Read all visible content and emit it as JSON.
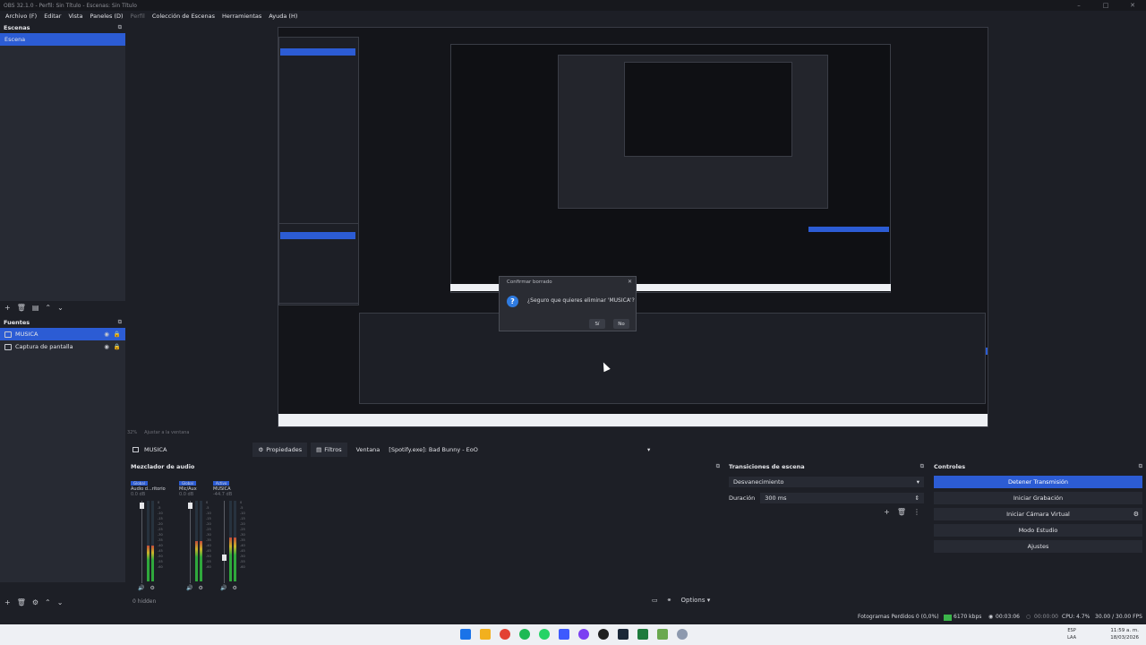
{
  "window": {
    "title": "OBS 32.1.0 - Perfil: Sin Título - Escenas: Sin Título"
  },
  "menu": [
    {
      "label": "Archivo (F)",
      "disabled": false
    },
    {
      "label": "Editar",
      "disabled": false
    },
    {
      "label": "Vista",
      "disabled": false
    },
    {
      "label": "Paneles (D)",
      "disabled": false
    },
    {
      "label": "Perfil",
      "disabled": true
    },
    {
      "label": "Colección de Escenas",
      "disabled": false
    },
    {
      "label": "Herramientas",
      "disabled": false
    },
    {
      "label": "Ayuda (H)",
      "disabled": false
    }
  ],
  "scenes": {
    "title": "Escenas",
    "items": [
      "Escena"
    ]
  },
  "sources": {
    "title": "Fuentes",
    "items": [
      "MUSICA",
      "Captura de pantalla"
    ]
  },
  "dialog": {
    "title": "Confirmar borrado",
    "message": "¿Seguro que quieres eliminar 'MUSICA'?",
    "yes": "Sí",
    "no": "No"
  },
  "preview": {
    "zoom": "32%",
    "zoom_mode": "Ajustar a la ventana"
  },
  "sourcebar": {
    "source": "MUSICA",
    "properties": "Propiedades",
    "filters": "Filtros",
    "window_label": "Ventana",
    "window_value": "[Spotify.exe]: Bad Bunny - EoO"
  },
  "mixer": {
    "title": "Mezclador de audio",
    "hidden": "0 hidden",
    "channels": [
      {
        "name": "Audio d...ritorio",
        "db": "0.0 dB",
        "tag": "Global",
        "level": 0.45
      },
      {
        "name": "Mic/Aux",
        "db": "0.0 dB",
        "tag": "Global",
        "level": 0.5
      },
      {
        "name": "MUSICA",
        "db": "-44.7 dB",
        "tag": "Activo",
        "level": 0.55
      }
    ],
    "ticks": [
      "0",
      "-5",
      "-10",
      "-15",
      "-20",
      "-25",
      "-30",
      "-35",
      "-40",
      "-45",
      "-50",
      "-55",
      "-60"
    ]
  },
  "transitions": {
    "title": "Transiciones de escena",
    "selected": "Desvanecimiento",
    "duration_label": "Duración",
    "duration_value": "300 ms"
  },
  "controls": {
    "title": "Controles",
    "buttons": [
      "Detener Transmisión",
      "Iniciar Grabación",
      "Iniciar Cámara Virtual",
      "Modo Estudio",
      "Ajustes"
    ]
  },
  "options": {
    "label": "Options"
  },
  "status": {
    "dropped": "Fotogramas Perdidos 0 (0,0%)",
    "bitrate": "6170 kbps",
    "stream_time": "00:03:06",
    "rec_time": "00:00:00",
    "cpu": "CPU: 4.7%",
    "fps": "30.00 / 30.00 FPS"
  },
  "taskbar": {
    "lang1": "ESP",
    "lang2": "LAA",
    "time": "11:59 a. m.",
    "date": "18/03/2026"
  },
  "colors": {
    "accent": "#2c5cd4",
    "bg": "#1d1f26",
    "panel": "#272a33"
  }
}
